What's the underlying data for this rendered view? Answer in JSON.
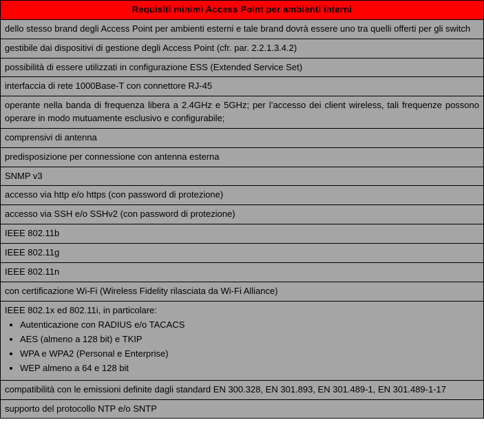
{
  "title": "Requisiti minimi Access Point per ambienti interni",
  "rows": [
    {
      "text": "dello stesso brand degli Access Point per ambienti esterni e tale brand dovrà essere uno tra quelli offerti per gli switch",
      "justify": true
    },
    {
      "text": "gestibile dai dispositivi di gestione degli Access Point (cfr. par. 2.2.1.3.4.2)"
    },
    {
      "text": "possibilità di essere utilizzati in configurazione ESS (Extended Service Set)"
    },
    {
      "text": "interfaccia di rete 1000Base-T con connettore RJ-45"
    },
    {
      "text": "operante nella banda di frequenza libera a 2.4GHz e 5GHz; per l’accesso dei client wireless, tali frequenze possono operare in modo mutuamente esclusivo e configurabile;",
      "justify": true
    },
    {
      "text": "comprensivi di antenna"
    },
    {
      "text": "predisposizione per connessione con antenna esterna"
    },
    {
      "text": "SNMP v3"
    },
    {
      "text": "accesso via http e/o https (con password di protezione)"
    },
    {
      "text": "accesso via SSH e/o SSHv2 (con password di protezione)"
    },
    {
      "text": "IEEE 802.11b"
    },
    {
      "text": "IEEE 802.11g"
    },
    {
      "text": "IEEE 802.11n"
    },
    {
      "text": "con certificazione Wi-Fi (Wireless Fidelity rilasciata da Wi-Fi Alliance)"
    },
    {
      "intro": "IEEE 802.1x ed 802.11i, in particolare:",
      "bullets": [
        "Autenticazione con RADIUS e/o TACACS",
        "AES (almeno a 128 bit) e TKIP",
        "WPA e WPA2 (Personal e Enterprise)",
        "WEP almeno a 64 e 128 bit"
      ]
    },
    {
      "text": "compatibilità con le emissioni definite dagli standard EN 300.328, EN 301.893, EN 301.489-1, EN 301.489-1-17",
      "justify": true
    },
    {
      "text": "supporto del protocollo NTP e/o SNTP"
    }
  ]
}
